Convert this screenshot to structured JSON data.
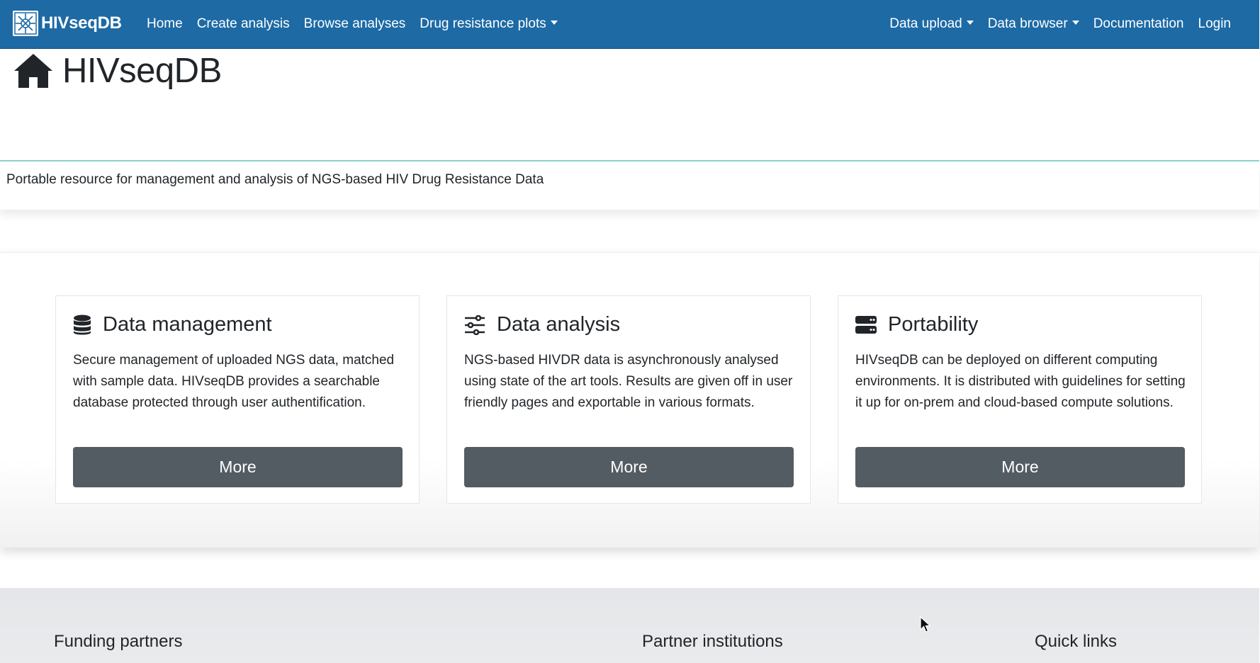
{
  "navbar": {
    "brand": "HIVseqDB",
    "left_links": [
      {
        "label": "Home",
        "dropdown": false
      },
      {
        "label": "Create analysis",
        "dropdown": false
      },
      {
        "label": "Browse analyses",
        "dropdown": false
      },
      {
        "label": "Drug resistance plots",
        "dropdown": true
      }
    ],
    "right_links": [
      {
        "label": "Data upload",
        "dropdown": true
      },
      {
        "label": "Data browser",
        "dropdown": true
      },
      {
        "label": "Documentation",
        "dropdown": false
      },
      {
        "label": "Login",
        "dropdown": false
      }
    ],
    "background_color": "#1d6aa5"
  },
  "header": {
    "title": "HIVseqDB",
    "icon": "home-icon",
    "subtitle": "Portable resource for management and analysis of NGS-based HIV Drug Resistance Data"
  },
  "cards": [
    {
      "icon": "database-icon",
      "title": "Data management",
      "text": "Secure management of uploaded NGS data, matched with sample data. HIVseqDB provides a searchable database protected through user authentification.",
      "button": "More"
    },
    {
      "icon": "sliders-icon",
      "title": "Data analysis",
      "text": "NGS-based HIVDR data is asynchronously analysed using state of the art tools. Results are given off in user friendly pages and exportable in various formats.",
      "button": "More"
    },
    {
      "icon": "server-icon",
      "title": "Portability",
      "text": "HIVseqDB can be deployed on different computing environments. It is distributed with guidelines for setting it up for on-prem and cloud-based compute solutions.",
      "button": "More"
    }
  ],
  "footer": {
    "funding": "Funding partners",
    "partners": "Partner institutions",
    "quick_links": "Quick links"
  },
  "colors": {
    "accent_rule": "#8ad2cc",
    "button_bg": "#545c63"
  }
}
